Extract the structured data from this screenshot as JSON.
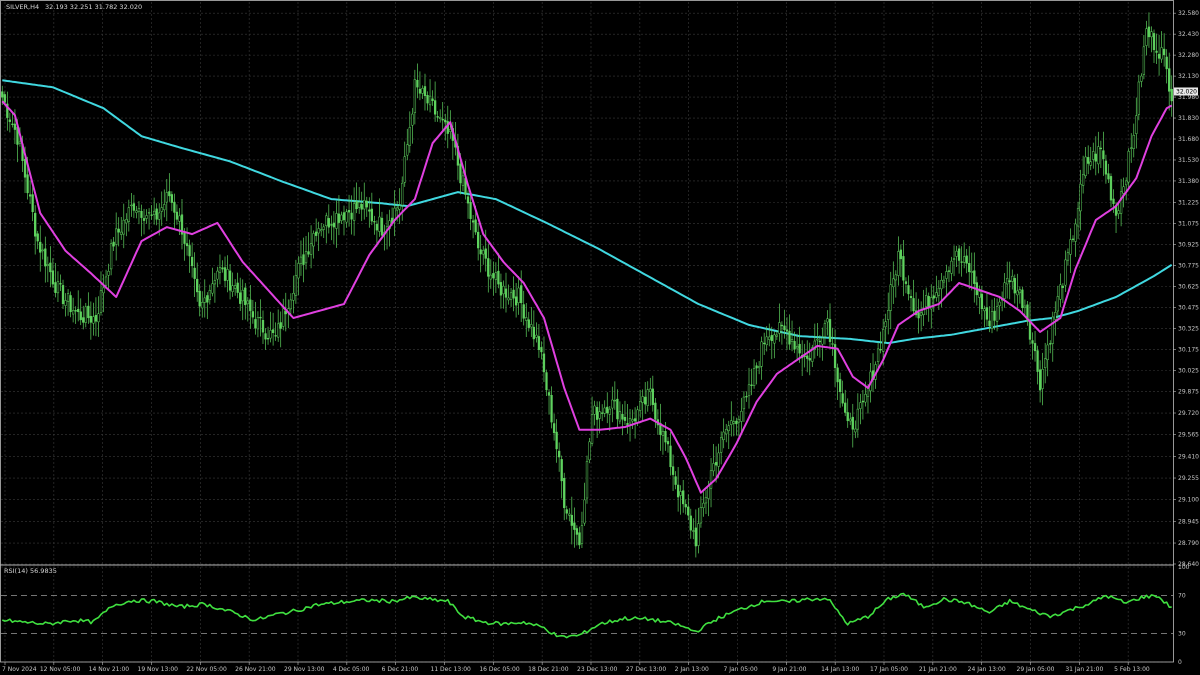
{
  "header": {
    "symbol_text": "SILVER,H4",
    "ohlc_text": "32.193 32.251 31.782 32.020"
  },
  "colors": {
    "background": "#000000",
    "grid": "#3a3a3a",
    "candles": "#5fd35f",
    "ma_fast": "#e040e0",
    "ma_slow": "#40d8e0",
    "rsi": "#40e040",
    "frame": "#bdbdbd"
  },
  "chart_data": [
    {
      "type": "candlestick",
      "symbol": "SILVER",
      "timeframe": "H4",
      "price_tick_labels": [
        "32.580",
        "32.430",
        "32.280",
        "32.130",
        "31.980",
        "31.830",
        "31.680",
        "31.530",
        "31.380",
        "31.225",
        "31.075",
        "30.925",
        "30.775",
        "30.625",
        "30.475",
        "30.325",
        "30.175",
        "30.025",
        "29.875",
        "29.720",
        "29.565",
        "29.410",
        "29.255",
        "29.100",
        "28.945",
        "28.790",
        "28.640"
      ],
      "price_range": [
        28.64,
        32.66
      ],
      "current_price": "32.020",
      "x_tick_labels": [
        "7 Nov 2024",
        "12 Nov 05:00",
        "14 Nov 21:00",
        "19 Nov 13:00",
        "22 Nov 05:00",
        "26 Nov 21:00",
        "29 Nov 13:00",
        "4 Dec 05:00",
        "6 Dec 21:00",
        "11 Dec 13:00",
        "16 Dec 05:00",
        "18 Dec 21:00",
        "23 Dec 13:00",
        "27 Dec 13:00",
        "2 Jan 13:00",
        "7 Jan 05:00",
        "9 Jan 21:00",
        "14 Jan 13:00",
        "17 Jan 05:00",
        "21 Jan 21:00",
        "24 Jan 13:00",
        "29 Jan 05:00",
        "31 Jan 21:00",
        "5 Feb 13:00"
      ],
      "close_anchors": [
        [
          0,
          31.98
        ],
        [
          6,
          31.7
        ],
        [
          14,
          30.95
        ],
        [
          22,
          30.6
        ],
        [
          30,
          30.42
        ],
        [
          37,
          30.4
        ],
        [
          44,
          30.95
        ],
        [
          52,
          31.22
        ],
        [
          60,
          31.1
        ],
        [
          66,
          31.28
        ],
        [
          71,
          31.05
        ],
        [
          78,
          30.45
        ],
        [
          85,
          30.75
        ],
        [
          91,
          30.65
        ],
        [
          100,
          30.38
        ],
        [
          108,
          30.25
        ],
        [
          116,
          30.7
        ],
        [
          124,
          31.05
        ],
        [
          134,
          31.15
        ],
        [
          142,
          31.2
        ],
        [
          150,
          31.05
        ],
        [
          157,
          31.22
        ],
        [
          163,
          32.05
        ],
        [
          170,
          31.9
        ],
        [
          178,
          31.65
        ],
        [
          182,
          31.35
        ],
        [
          188,
          30.9
        ],
        [
          196,
          30.62
        ],
        [
          204,
          30.55
        ],
        [
          212,
          30.2
        ],
        [
          218,
          29.6
        ],
        [
          222,
          29.1
        ],
        [
          228,
          28.8
        ],
        [
          233,
          29.7
        ],
        [
          240,
          29.8
        ],
        [
          248,
          29.65
        ],
        [
          256,
          29.85
        ],
        [
          262,
          29.5
        ],
        [
          268,
          29.1
        ],
        [
          274,
          28.82
        ],
        [
          280,
          29.3
        ],
        [
          286,
          29.6
        ],
        [
          294,
          29.8
        ],
        [
          302,
          30.3
        ],
        [
          310,
          30.3
        ],
        [
          318,
          30.1
        ],
        [
          326,
          30.4
        ],
        [
          334,
          29.6
        ],
        [
          340,
          29.75
        ],
        [
          348,
          30.3
        ],
        [
          354,
          30.85
        ],
        [
          362,
          30.4
        ],
        [
          368,
          30.6
        ],
        [
          376,
          30.85
        ],
        [
          382,
          30.75
        ],
        [
          390,
          30.35
        ],
        [
          398,
          30.7
        ],
        [
          404,
          30.5
        ],
        [
          410,
          29.95
        ],
        [
          416,
          30.45
        ],
        [
          422,
          30.9
        ],
        [
          428,
          31.5
        ],
        [
          434,
          31.6
        ],
        [
          440,
          31.15
        ],
        [
          446,
          31.6
        ],
        [
          452,
          32.45
        ],
        [
          458,
          32.3
        ],
        [
          462,
          32.02
        ]
      ],
      "ma_fast_anchors": [
        [
          0,
          31.95
        ],
        [
          5,
          31.85
        ],
        [
          15,
          31.15
        ],
        [
          25,
          30.88
        ],
        [
          35,
          30.72
        ],
        [
          45,
          30.55
        ],
        [
          55,
          30.95
        ],
        [
          65,
          31.05
        ],
        [
          75,
          31.0
        ],
        [
          85,
          31.08
        ],
        [
          95,
          30.8
        ],
        [
          105,
          30.6
        ],
        [
          115,
          30.4
        ],
        [
          125,
          30.45
        ],
        [
          135,
          30.5
        ],
        [
          145,
          30.85
        ],
        [
          155,
          31.1
        ],
        [
          163,
          31.25
        ],
        [
          170,
          31.65
        ],
        [
          177,
          31.8
        ],
        [
          184,
          31.35
        ],
        [
          190,
          31.0
        ],
        [
          198,
          30.8
        ],
        [
          206,
          30.65
        ],
        [
          214,
          30.4
        ],
        [
          222,
          29.9
        ],
        [
          228,
          29.6
        ],
        [
          236,
          29.6
        ],
        [
          246,
          29.62
        ],
        [
          256,
          29.68
        ],
        [
          264,
          29.6
        ],
        [
          270,
          29.4
        ],
        [
          276,
          29.15
        ],
        [
          282,
          29.25
        ],
        [
          290,
          29.5
        ],
        [
          298,
          29.8
        ],
        [
          306,
          30.0
        ],
        [
          314,
          30.1
        ],
        [
          322,
          30.2
        ],
        [
          330,
          30.18
        ],
        [
          336,
          29.98
        ],
        [
          342,
          29.9
        ],
        [
          348,
          30.1
        ],
        [
          354,
          30.35
        ],
        [
          362,
          30.45
        ],
        [
          370,
          30.5
        ],
        [
          378,
          30.65
        ],
        [
          386,
          30.6
        ],
        [
          394,
          30.55
        ],
        [
          402,
          30.45
        ],
        [
          410,
          30.3
        ],
        [
          418,
          30.4
        ],
        [
          424,
          30.75
        ],
        [
          432,
          31.1
        ],
        [
          440,
          31.2
        ],
        [
          448,
          31.4
        ],
        [
          454,
          31.7
        ],
        [
          460,
          31.9
        ],
        [
          462,
          31.92
        ]
      ],
      "ma_slow_anchors": [
        [
          0,
          32.1
        ],
        [
          20,
          32.05
        ],
        [
          40,
          31.9
        ],
        [
          55,
          31.7
        ],
        [
          70,
          31.62
        ],
        [
          90,
          31.52
        ],
        [
          110,
          31.38
        ],
        [
          130,
          31.25
        ],
        [
          150,
          31.22
        ],
        [
          160,
          31.2
        ],
        [
          170,
          31.25
        ],
        [
          180,
          31.3
        ],
        [
          195,
          31.25
        ],
        [
          215,
          31.08
        ],
        [
          235,
          30.9
        ],
        [
          255,
          30.7
        ],
        [
          275,
          30.5
        ],
        [
          295,
          30.35
        ],
        [
          315,
          30.27
        ],
        [
          335,
          30.25
        ],
        [
          350,
          30.22
        ],
        [
          360,
          30.25
        ],
        [
          375,
          30.28
        ],
        [
          390,
          30.33
        ],
        [
          405,
          30.38
        ],
        [
          415,
          30.4
        ],
        [
          425,
          30.45
        ],
        [
          440,
          30.55
        ],
        [
          455,
          30.7
        ],
        [
          462,
          30.78
        ]
      ]
    },
    {
      "type": "line",
      "title": "RSI(14) 56.9835",
      "y_tick_labels": [
        "100",
        "70",
        "30",
        "0"
      ],
      "y_range": [
        0,
        100
      ],
      "levels": [
        70,
        30
      ],
      "anchors": [
        [
          0,
          44
        ],
        [
          8,
          42
        ],
        [
          18,
          40
        ],
        [
          28,
          44
        ],
        [
          36,
          42
        ],
        [
          44,
          60
        ],
        [
          52,
          65
        ],
        [
          60,
          64
        ],
        [
          70,
          58
        ],
        [
          80,
          61
        ],
        [
          90,
          53
        ],
        [
          100,
          44
        ],
        [
          108,
          50
        ],
        [
          116,
          54
        ],
        [
          124,
          60
        ],
        [
          134,
          63
        ],
        [
          144,
          65
        ],
        [
          154,
          64
        ],
        [
          162,
          68
        ],
        [
          168,
          66
        ],
        [
          176,
          64
        ],
        [
          182,
          48
        ],
        [
          190,
          42
        ],
        [
          198,
          40
        ],
        [
          206,
          42
        ],
        [
          214,
          36
        ],
        [
          220,
          26
        ],
        [
          228,
          28
        ],
        [
          236,
          40
        ],
        [
          246,
          46
        ],
        [
          256,
          45
        ],
        [
          266,
          40
        ],
        [
          274,
          32
        ],
        [
          282,
          45
        ],
        [
          292,
          56
        ],
        [
          302,
          65
        ],
        [
          310,
          63
        ],
        [
          318,
          66
        ],
        [
          326,
          67
        ],
        [
          334,
          40
        ],
        [
          342,
          48
        ],
        [
          350,
          66
        ],
        [
          356,
          72
        ],
        [
          364,
          58
        ],
        [
          372,
          66
        ],
        [
          380,
          63
        ],
        [
          390,
          52
        ],
        [
          398,
          64
        ],
        [
          406,
          55
        ],
        [
          414,
          48
        ],
        [
          422,
          55
        ],
        [
          430,
          62
        ],
        [
          436,
          70
        ],
        [
          444,
          62
        ],
        [
          450,
          68
        ],
        [
          456,
          70
        ],
        [
          462,
          57
        ]
      ]
    }
  ]
}
